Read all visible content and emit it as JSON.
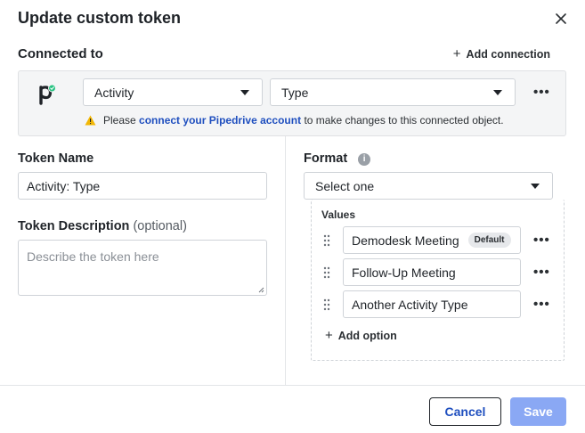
{
  "dialog": {
    "title": "Update custom token",
    "close_icon": "close-icon"
  },
  "connected": {
    "label": "Connected to",
    "add_connection": "Add connection",
    "logo_icon": "pipedrive-logo-icon",
    "object_select": "Activity",
    "field_select": "Type",
    "warning_prefix": "Please",
    "warning_link": "connect your Pipedrive account",
    "warning_suffix": "to make changes to this connected object."
  },
  "token_name": {
    "label": "Token Name",
    "value": "Activity: Type"
  },
  "token_description": {
    "label": "Token Description",
    "optional": "(optional)",
    "placeholder": "Describe the token here"
  },
  "format": {
    "label": "Format",
    "selected": "Select one",
    "values_label": "Values",
    "values": [
      {
        "label": "Demodesk Meeting",
        "badge": "Default"
      },
      {
        "label": "Follow-Up Meeting"
      },
      {
        "label": "Another Activity Type"
      }
    ],
    "add_option": "Add option"
  },
  "footer": {
    "cancel": "Cancel",
    "save": "Save"
  },
  "colors": {
    "link": "#1f4fbf",
    "save_button": "#8aa8f4",
    "warning": "#f2b705",
    "pipedrive_badge": "#26c281"
  }
}
